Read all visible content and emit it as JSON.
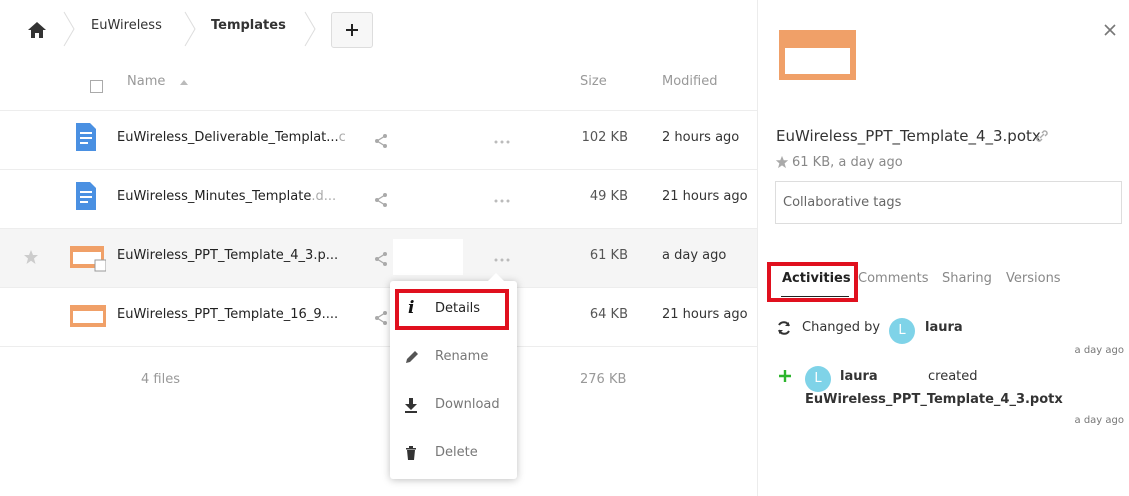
{
  "breadcrumb": {
    "items": [
      "EuWireless",
      "Templates"
    ],
    "add_label": "+"
  },
  "table": {
    "headers": {
      "name": "Name",
      "size": "Size",
      "modified": "Modified"
    },
    "rows": [
      {
        "name": "EuWireless_Deliverable_Templat...",
        "ext": "c",
        "size": "102 KB",
        "modified": "2 hours ago",
        "type": "doc"
      },
      {
        "name": "EuWireless_Minutes_Template",
        "ext": ".d...",
        "size": "49 KB",
        "modified": "21 hours ago",
        "type": "doc"
      },
      {
        "name": "EuWireless_PPT_Template_4_3.p...",
        "ext": "",
        "size": "61 KB",
        "modified": "a day ago",
        "type": "ppt"
      },
      {
        "name": "EuWireless_PPT_Template_16_9....",
        "ext": "",
        "size": "64 KB",
        "modified": "21 hours ago",
        "type": "ppt"
      }
    ],
    "summary": {
      "count": "4 files",
      "size": "276 KB"
    }
  },
  "context_menu": {
    "items": [
      "Details",
      "Rename",
      "Download",
      "Delete"
    ],
    "details_glyph": "i"
  },
  "sidebar": {
    "file_name": "EuWireless_PPT_Template_4_3.potx",
    "meta": "61 KB, a day ago",
    "tags_placeholder": "Collaborative tags",
    "tabs": [
      "Activities",
      "Comments",
      "Sharing",
      "Versions"
    ],
    "activities": [
      {
        "prefix": "Changed by",
        "avatar": "L",
        "user": "laura",
        "time": "a day ago"
      },
      {
        "avatar": "L",
        "user": "laura",
        "action": "created",
        "file": "EuWireless_PPT_Template_4_3.potx",
        "time": "a day ago"
      }
    ],
    "close_glyph": "×"
  },
  "colors": {
    "doc_icon": "#4a90e2",
    "ppt_icon": "#f0a068",
    "highlight": "#e0101e",
    "avatar": "#7fd3e8",
    "plus": "#2db52d"
  }
}
